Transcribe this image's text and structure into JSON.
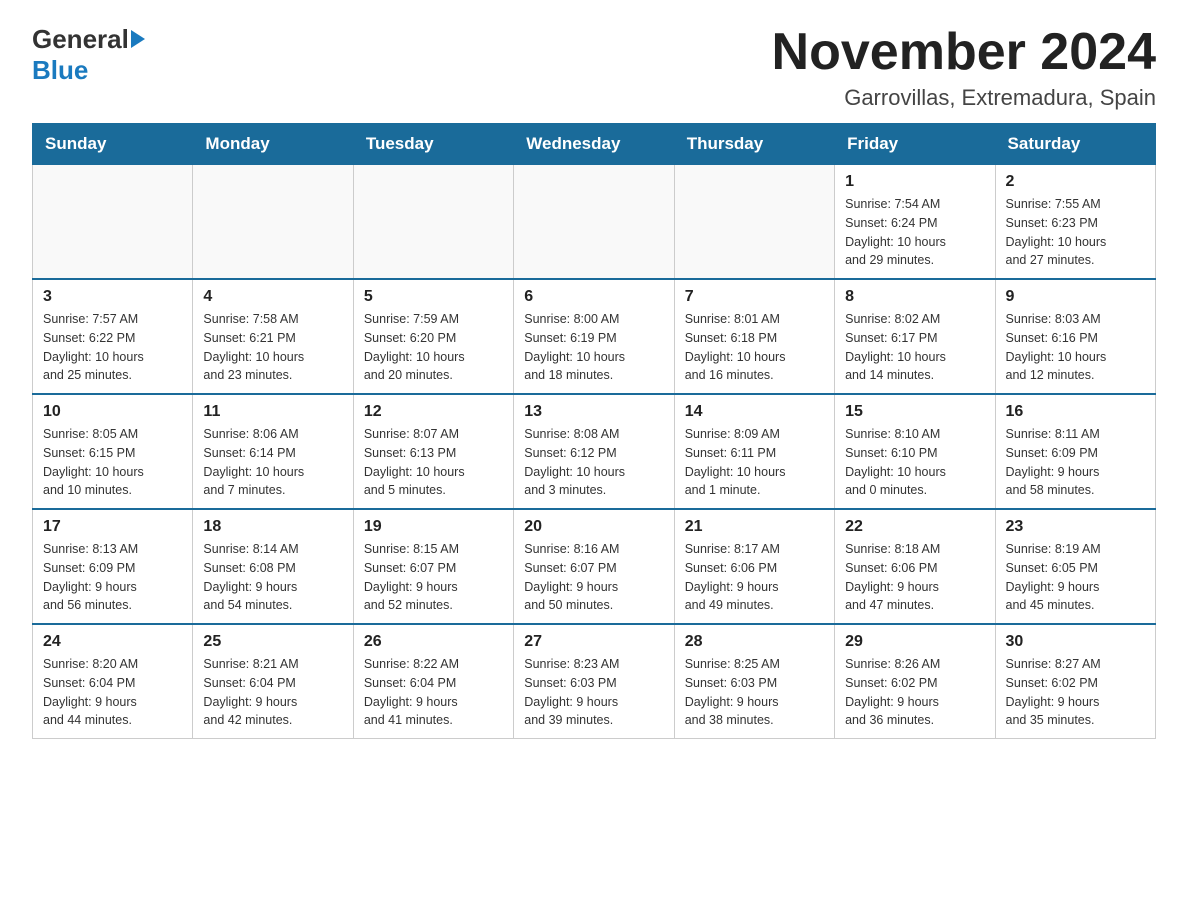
{
  "logo": {
    "general": "General",
    "blue": "Blue"
  },
  "header": {
    "title": "November 2024",
    "subtitle": "Garrovillas, Extremadura, Spain"
  },
  "days_of_week": [
    "Sunday",
    "Monday",
    "Tuesday",
    "Wednesday",
    "Thursday",
    "Friday",
    "Saturday"
  ],
  "weeks": [
    [
      {
        "day": "",
        "info": ""
      },
      {
        "day": "",
        "info": ""
      },
      {
        "day": "",
        "info": ""
      },
      {
        "day": "",
        "info": ""
      },
      {
        "day": "",
        "info": ""
      },
      {
        "day": "1",
        "info": "Sunrise: 7:54 AM\nSunset: 6:24 PM\nDaylight: 10 hours\nand 29 minutes."
      },
      {
        "day": "2",
        "info": "Sunrise: 7:55 AM\nSunset: 6:23 PM\nDaylight: 10 hours\nand 27 minutes."
      }
    ],
    [
      {
        "day": "3",
        "info": "Sunrise: 7:57 AM\nSunset: 6:22 PM\nDaylight: 10 hours\nand 25 minutes."
      },
      {
        "day": "4",
        "info": "Sunrise: 7:58 AM\nSunset: 6:21 PM\nDaylight: 10 hours\nand 23 minutes."
      },
      {
        "day": "5",
        "info": "Sunrise: 7:59 AM\nSunset: 6:20 PM\nDaylight: 10 hours\nand 20 minutes."
      },
      {
        "day": "6",
        "info": "Sunrise: 8:00 AM\nSunset: 6:19 PM\nDaylight: 10 hours\nand 18 minutes."
      },
      {
        "day": "7",
        "info": "Sunrise: 8:01 AM\nSunset: 6:18 PM\nDaylight: 10 hours\nand 16 minutes."
      },
      {
        "day": "8",
        "info": "Sunrise: 8:02 AM\nSunset: 6:17 PM\nDaylight: 10 hours\nand 14 minutes."
      },
      {
        "day": "9",
        "info": "Sunrise: 8:03 AM\nSunset: 6:16 PM\nDaylight: 10 hours\nand 12 minutes."
      }
    ],
    [
      {
        "day": "10",
        "info": "Sunrise: 8:05 AM\nSunset: 6:15 PM\nDaylight: 10 hours\nand 10 minutes."
      },
      {
        "day": "11",
        "info": "Sunrise: 8:06 AM\nSunset: 6:14 PM\nDaylight: 10 hours\nand 7 minutes."
      },
      {
        "day": "12",
        "info": "Sunrise: 8:07 AM\nSunset: 6:13 PM\nDaylight: 10 hours\nand 5 minutes."
      },
      {
        "day": "13",
        "info": "Sunrise: 8:08 AM\nSunset: 6:12 PM\nDaylight: 10 hours\nand 3 minutes."
      },
      {
        "day": "14",
        "info": "Sunrise: 8:09 AM\nSunset: 6:11 PM\nDaylight: 10 hours\nand 1 minute."
      },
      {
        "day": "15",
        "info": "Sunrise: 8:10 AM\nSunset: 6:10 PM\nDaylight: 10 hours\nand 0 minutes."
      },
      {
        "day": "16",
        "info": "Sunrise: 8:11 AM\nSunset: 6:09 PM\nDaylight: 9 hours\nand 58 minutes."
      }
    ],
    [
      {
        "day": "17",
        "info": "Sunrise: 8:13 AM\nSunset: 6:09 PM\nDaylight: 9 hours\nand 56 minutes."
      },
      {
        "day": "18",
        "info": "Sunrise: 8:14 AM\nSunset: 6:08 PM\nDaylight: 9 hours\nand 54 minutes."
      },
      {
        "day": "19",
        "info": "Sunrise: 8:15 AM\nSunset: 6:07 PM\nDaylight: 9 hours\nand 52 minutes."
      },
      {
        "day": "20",
        "info": "Sunrise: 8:16 AM\nSunset: 6:07 PM\nDaylight: 9 hours\nand 50 minutes."
      },
      {
        "day": "21",
        "info": "Sunrise: 8:17 AM\nSunset: 6:06 PM\nDaylight: 9 hours\nand 49 minutes."
      },
      {
        "day": "22",
        "info": "Sunrise: 8:18 AM\nSunset: 6:06 PM\nDaylight: 9 hours\nand 47 minutes."
      },
      {
        "day": "23",
        "info": "Sunrise: 8:19 AM\nSunset: 6:05 PM\nDaylight: 9 hours\nand 45 minutes."
      }
    ],
    [
      {
        "day": "24",
        "info": "Sunrise: 8:20 AM\nSunset: 6:04 PM\nDaylight: 9 hours\nand 44 minutes."
      },
      {
        "day": "25",
        "info": "Sunrise: 8:21 AM\nSunset: 6:04 PM\nDaylight: 9 hours\nand 42 minutes."
      },
      {
        "day": "26",
        "info": "Sunrise: 8:22 AM\nSunset: 6:04 PM\nDaylight: 9 hours\nand 41 minutes."
      },
      {
        "day": "27",
        "info": "Sunrise: 8:23 AM\nSunset: 6:03 PM\nDaylight: 9 hours\nand 39 minutes."
      },
      {
        "day": "28",
        "info": "Sunrise: 8:25 AM\nSunset: 6:03 PM\nDaylight: 9 hours\nand 38 minutes."
      },
      {
        "day": "29",
        "info": "Sunrise: 8:26 AM\nSunset: 6:02 PM\nDaylight: 9 hours\nand 36 minutes."
      },
      {
        "day": "30",
        "info": "Sunrise: 8:27 AM\nSunset: 6:02 PM\nDaylight: 9 hours\nand 35 minutes."
      }
    ]
  ]
}
